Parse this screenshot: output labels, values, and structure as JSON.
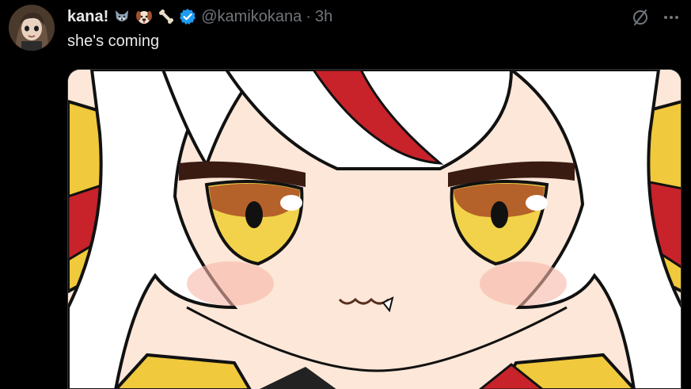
{
  "tweet": {
    "display_name": "kana!",
    "emoji_icons": [
      "wolf-icon",
      "dog-icon",
      "bone-icon"
    ],
    "handle": "@kamikokana",
    "separator": "·",
    "time": "3h",
    "text": "she's coming",
    "media_alt": "anime girl close-up"
  },
  "colors": {
    "background": "#000000",
    "text": "#e7e9ea",
    "muted": "#71767b",
    "verified": "#1d9bf0"
  }
}
